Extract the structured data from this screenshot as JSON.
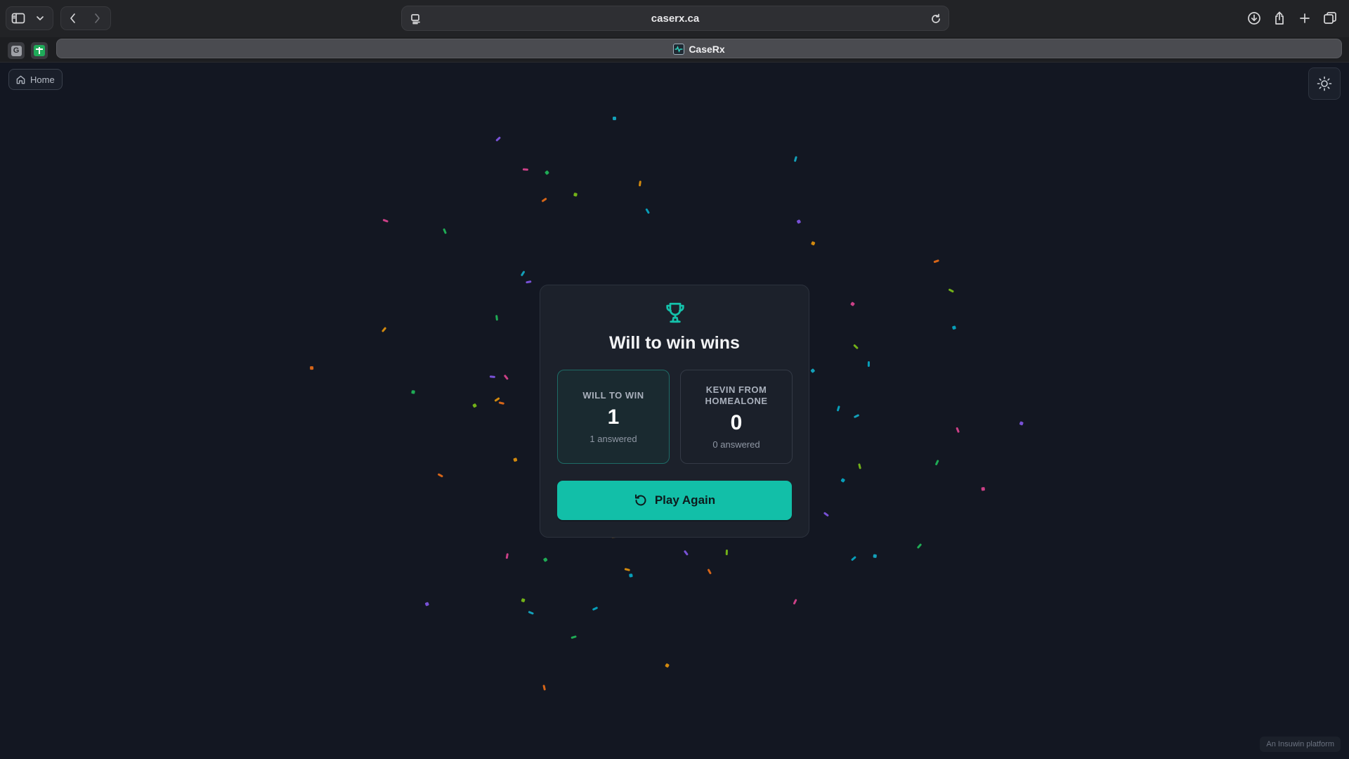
{
  "browser": {
    "url": "caserx.ca",
    "tab_title": "CaseRx",
    "pinned_tabs": [
      {
        "letter": "G"
      },
      {
        "letter": ""
      }
    ]
  },
  "page": {
    "home_label": "Home",
    "footer": "An Insuwin platform"
  },
  "result": {
    "title": "Will to win wins",
    "teams": [
      {
        "name": "WILL TO WIN",
        "score": "1",
        "answered": "1 answered"
      },
      {
        "name": "KEVIN FROM HOMEALONE",
        "score": "0",
        "answered": "0 answered"
      }
    ],
    "play_again_label": "Play Again"
  },
  "colors": {
    "accent": "#12bfa8",
    "background": "#131722",
    "card": "#1c212b"
  }
}
